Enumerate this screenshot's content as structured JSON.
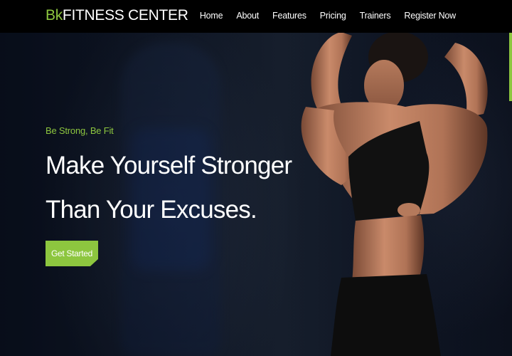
{
  "brand": {
    "prefix": "Bk",
    "name": "FITNESS CENTER",
    "accent_color": "#8dc63f"
  },
  "nav": {
    "items": [
      {
        "label": "Home"
      },
      {
        "label": "About"
      },
      {
        "label": "Features"
      },
      {
        "label": "Pricing"
      },
      {
        "label": "Trainers"
      },
      {
        "label": "Register Now"
      }
    ]
  },
  "hero": {
    "tagline": "Be Strong, Be Fit",
    "headline_line1": "Make Yourself Stronger",
    "headline_line2": "Than Your Excuses.",
    "cta_label": "Get Started",
    "image": "athlete-woman-back-photo"
  }
}
